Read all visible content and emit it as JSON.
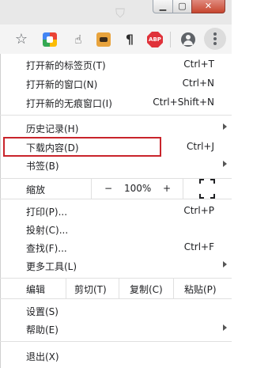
{
  "toolbar": {
    "star_glyph": "☆",
    "hand_glyph": "☝",
    "para_glyph": "¶",
    "abp_text": "ABP",
    "min_glyph": "▁",
    "max_glyph": "▢",
    "close_glyph": "✕"
  },
  "menu": {
    "new_tab": {
      "label": "打开新的标签页(T)",
      "shortcut": "Ctrl+T"
    },
    "new_window": {
      "label": "打开新的窗口(N)",
      "shortcut": "Ctrl+N"
    },
    "new_incognito": {
      "label": "打开新的无痕窗口(I)",
      "shortcut": "Ctrl+Shift+N"
    },
    "history": {
      "label": "历史记录(H)"
    },
    "downloads": {
      "label": "下载内容(D)",
      "shortcut": "Ctrl+J"
    },
    "bookmarks": {
      "label": "书签(B)"
    },
    "zoom": {
      "label": "缩放",
      "minus": "−",
      "value": "100%",
      "plus": "+"
    },
    "print": {
      "label": "打印(P)...",
      "shortcut": "Ctrl+P"
    },
    "cast": {
      "label": "投射(C)..."
    },
    "find": {
      "label": "查找(F)...",
      "shortcut": "Ctrl+F"
    },
    "more_tools": {
      "label": "更多工具(L)"
    },
    "edit": {
      "label": "编辑",
      "cut": "剪切(T)",
      "copy": "复制(C)",
      "paste": "粘贴(P)"
    },
    "settings": {
      "label": "设置(S)"
    },
    "help": {
      "label": "帮助(E)"
    },
    "exit": {
      "label": "退出(X)"
    }
  },
  "colors": {
    "highlight_border": "#c9242b",
    "menu_bg": "#ffffff",
    "toolbar_bg": "#f4f4f4"
  }
}
